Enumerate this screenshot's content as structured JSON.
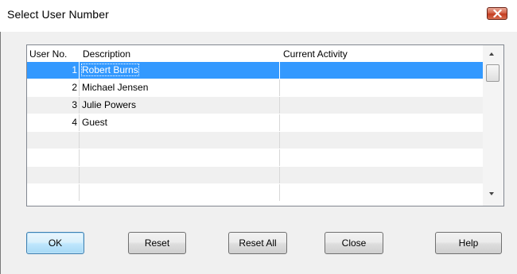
{
  "window": {
    "title": "Select User Number",
    "close_icon": "close-icon"
  },
  "grid": {
    "columns": [
      "User No.",
      "Description",
      "Current Activity"
    ],
    "rows": [
      {
        "num": "1",
        "desc": "Robert Burns",
        "activity": "",
        "selected": true
      },
      {
        "num": "2",
        "desc": "Michael Jensen",
        "activity": ""
      },
      {
        "num": "3",
        "desc": "Julie Powers",
        "activity": ""
      },
      {
        "num": "4",
        "desc": "Guest",
        "activity": ""
      },
      {
        "num": "",
        "desc": "",
        "activity": ""
      },
      {
        "num": "",
        "desc": "",
        "activity": ""
      },
      {
        "num": "",
        "desc": "",
        "activity": ""
      },
      {
        "num": "",
        "desc": "",
        "activity": ""
      }
    ],
    "selection_color": "#3399ff",
    "alt_row_color": "#f0f0f0"
  },
  "buttons": {
    "ok": "OK",
    "reset": "Reset",
    "reset_all": "Reset All",
    "close": "Close",
    "help": "Help"
  }
}
